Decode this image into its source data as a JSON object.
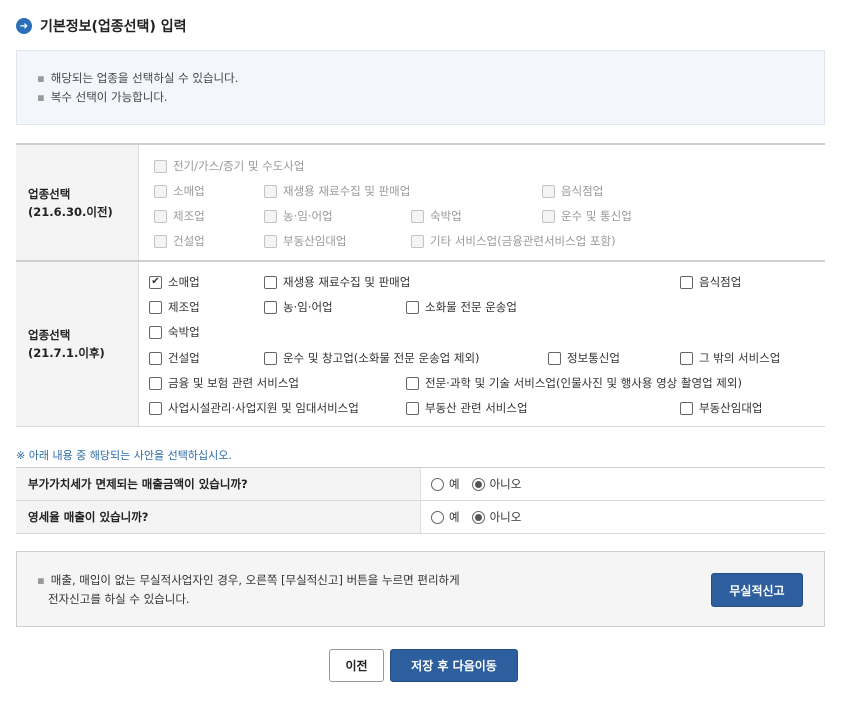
{
  "title": "기본정보(업종선택) 입력",
  "info": {
    "lines": [
      "해당되는 업종을 선택하실 수 있습니다.",
      "복수 선택이 가능합니다."
    ]
  },
  "old_section": {
    "head_line1": "업종선택",
    "head_line2": "(21.6.30.이전)",
    "options": [
      "전기/가스/증기 및 수도사업",
      "소매업",
      "재생용 재료수집 및 판매업",
      "음식점업",
      "제조업",
      "농·임·어업",
      "숙박업",
      "운수 및 통신업",
      "건설업",
      "부동산임대업",
      "기타 서비스업(금융관련서비스업 포함)"
    ]
  },
  "new_section": {
    "head_line1": "업종선택",
    "head_line2": "(21.7.1.이후)",
    "options": [
      {
        "label": "소매업",
        "checked": true
      },
      {
        "label": "재생용 재료수집 및 판매업",
        "checked": false
      },
      {
        "label": "음식점업",
        "checked": false
      },
      {
        "label": "제조업",
        "checked": false
      },
      {
        "label": "농·임·어업",
        "checked": false
      },
      {
        "label": "소화물 전문 운송업",
        "checked": false
      },
      {
        "label": "숙박업",
        "checked": false
      },
      {
        "label": "건설업",
        "checked": false
      },
      {
        "label": "운수 및 창고업(소화물 전문 운송업 제외)",
        "checked": false
      },
      {
        "label": "정보통신업",
        "checked": false
      },
      {
        "label": "그 밖의 서비스업",
        "checked": false
      },
      {
        "label": "금융 및 보험 관련 서비스업",
        "checked": false
      },
      {
        "label": "전문·과학 및 기술 서비스업(인물사진 및 행사용 영상 촬영업 제외)",
        "checked": false
      },
      {
        "label": "사업시설관리·사업지원 및 임대서비스업",
        "checked": false
      },
      {
        "label": "부동산 관련 서비스업",
        "checked": false
      },
      {
        "label": "부동산임대업",
        "checked": false
      }
    ]
  },
  "notice": "※ 아래 내용 중 해당되는 사안을 선택하십시오.",
  "questions": [
    {
      "label": "부가가치세가 면제되는 매출금액이 있습니까?",
      "yes": "예",
      "no": "아니오",
      "selected": "no"
    },
    {
      "label": "영세율 매출이 있습니까?",
      "yes": "예",
      "no": "아니오",
      "selected": "no"
    }
  ],
  "bottom": {
    "line1": "매출, 매입이 없는 무실적사업자인 경우, 오른쪽 [무실적신고] 버튼을 누르면 편리하게",
    "line2": "전자신고를 하실 수 있습니다.",
    "button": "무실적신고"
  },
  "buttons": {
    "prev": "이전",
    "save": "저장 후 다음이동"
  },
  "colors": {
    "accent": "#2d5f9e",
    "info_bg": "#f3f7fc",
    "notice_text": "#2a6aa8"
  }
}
